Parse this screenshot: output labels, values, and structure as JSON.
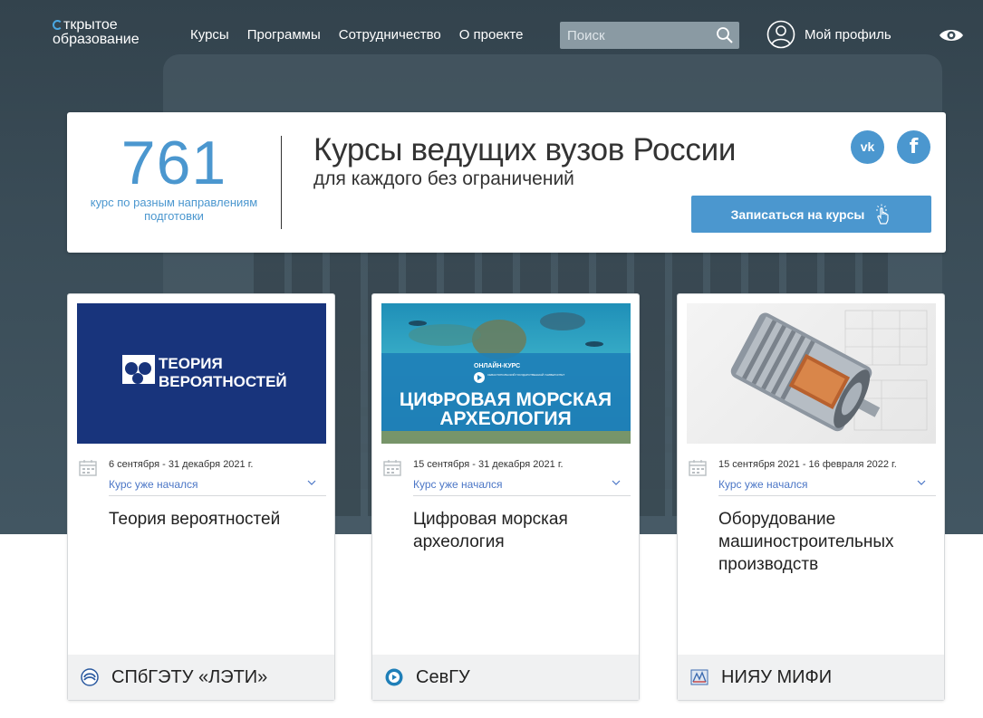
{
  "nav": {
    "logo_line1": "ткрытое",
    "logo_line2": "образование",
    "links": [
      "Курсы",
      "Программы",
      "Сотрудничество",
      "О проекте"
    ],
    "search_placeholder": "Поиск",
    "profile_label": "Мой профиль"
  },
  "banner": {
    "count": "761",
    "count_label": "курс по разным направлениям подготовки",
    "headline": "Курсы ведущих вузов России",
    "subline": "для каждого без ограничений",
    "vk_label": "vk",
    "fb_label": "f",
    "enroll_label": "Записаться на курсы"
  },
  "cards": [
    {
      "image_text_1": "ТЕОРИЯ",
      "image_text_2": "ВЕРОЯТНОСТЕЙ",
      "dates": "6 сентября - 31 декабря 2021 г.",
      "status": "Курс уже начался",
      "title": "Теория вероятностей",
      "university": "СПбГЭТУ «ЛЭТИ»"
    },
    {
      "image_badge": "ОНЛАЙН-КУРС",
      "image_org": "СЕВАСТОПОЛЬСКИЙ ГОСУДАРСТВЕННЫЙ УНИВЕРСИТЕТ",
      "image_text_1": "ЦИФРОВАЯ МОРСКАЯ",
      "image_text_2": "АРХЕОЛОГИЯ",
      "dates": "15 сентября - 31 декабря 2021 г.",
      "status": "Курс уже начался",
      "title": "Цифровая морская археология",
      "university": "СевГУ"
    },
    {
      "dates": "15 сентября 2021 - 16 февраля 2022 г.",
      "status": "Курс уже начался",
      "title": "Оборудование машиностроительных производств",
      "university": "НИЯУ МИФИ"
    }
  ],
  "colors": {
    "accent": "#4b97cf",
    "status_link": "#4b76c6",
    "hero_bg": "#3a4c57"
  }
}
